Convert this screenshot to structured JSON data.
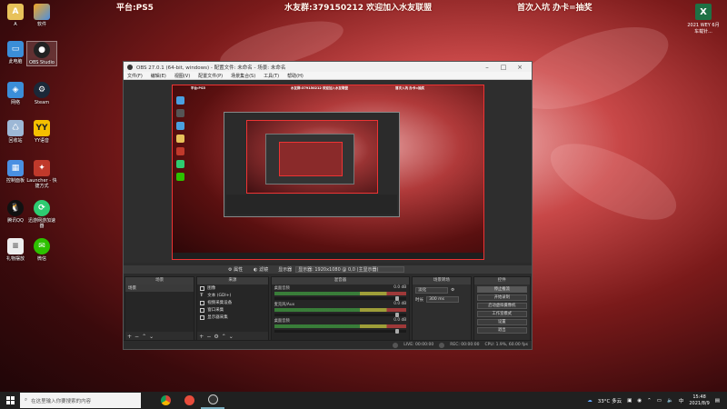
{
  "banner": {
    "platform": "平台:PS5",
    "group": "水友群:379150212 欢迎加入水友联盟",
    "lottery": "首次入坑 办卡=抽奖"
  },
  "desktop": {
    "icons": [
      {
        "label": "A"
      },
      {
        "label": "软件"
      },
      {
        "label": "此电脑"
      },
      {
        "label": "OBS Studio"
      },
      {
        "label": "网络"
      },
      {
        "label": "Steam"
      },
      {
        "label": "回收站"
      },
      {
        "label": "YY语音"
      },
      {
        "label": "控制面板"
      },
      {
        "label": "Launcher - 快捷方式"
      },
      {
        "label": "腾讯QQ"
      },
      {
        "label": "迅游网游加速器"
      },
      {
        "label": "礼物摆放"
      },
      {
        "label": "微信"
      }
    ],
    "excel": {
      "label": "2021 WEY 6月车载针..."
    }
  },
  "obs": {
    "title": "OBS 27.0.1 (64-bit, windows) - 配置文件: 未命名 - 场景: 未命名",
    "menu": [
      "文件(F)",
      "编辑(E)",
      "视图(V)",
      "配置文件(P)",
      "场景集合(S)",
      "工具(T)",
      "帮助(H)"
    ],
    "toolbar": {
      "properties": "属性",
      "filters": "滤镜",
      "display_label": "显示器",
      "display_value": "显示器: 1920x1080 @ 0,0 (主显示器)"
    },
    "docks": {
      "scenes_title": "场景",
      "scenes": [
        "场景"
      ],
      "sources_title": "来源",
      "sources": [
        "图像",
        "文本 (GDI+)",
        "视频采集设备",
        "窗口采集",
        "显示器采集"
      ],
      "mixer_title": "混音器",
      "mixer": [
        {
          "name": "桌面音频",
          "db": "0.0 dB"
        },
        {
          "name": "麦克风/Aux",
          "db": "0.0 dB"
        },
        {
          "name": "桌面音频",
          "db": "0.0 dB"
        }
      ],
      "transitions_title": "场景转场",
      "transition_type": "淡化",
      "duration_label": "时长",
      "duration_value": "300 ms",
      "controls_title": "控件",
      "controls": [
        "停止推流",
        "开始录制",
        "启动虚拟摄像机",
        "工作室模式",
        "设置",
        "退出"
      ]
    },
    "status": {
      "live": "LIVE: 00:00:00",
      "rec": "REC: 00:00:00",
      "cpu": "CPU: 1.9%, 60.00 fps"
    }
  },
  "taskbar": {
    "search_placeholder": "在这里输入你要搜索的内容",
    "weather": "33°C 多云",
    "time": "15:48",
    "date": "2021/8/9"
  }
}
